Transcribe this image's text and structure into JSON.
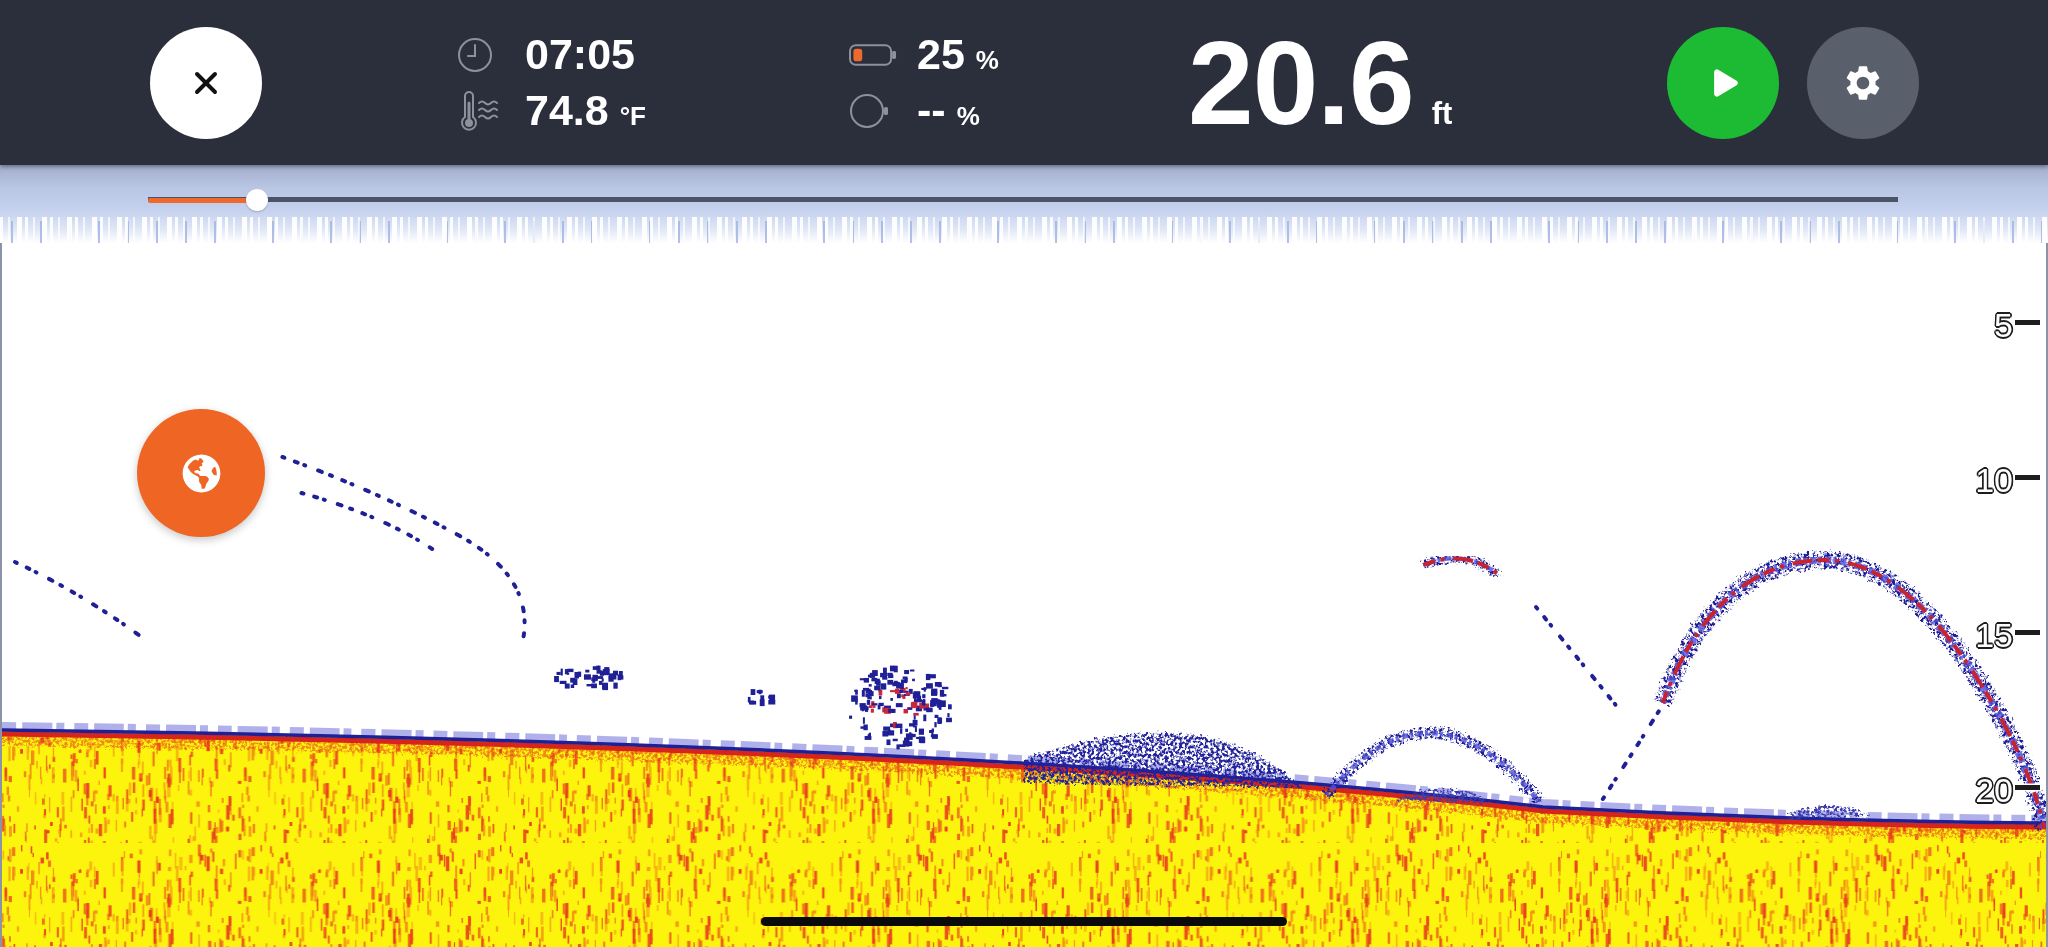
{
  "status": {
    "time": "07:05",
    "temperature": {
      "value": "74.8",
      "unit": "°F"
    },
    "battery": {
      "value": "25",
      "unit": "%"
    },
    "device_level": {
      "value": "--",
      "unit": "%"
    }
  },
  "depth": {
    "value": "20.6",
    "unit": "ft"
  },
  "history_slider": {
    "level": 0.062
  },
  "depth_scale": [
    "5",
    "10",
    "15",
    "20"
  ]
}
